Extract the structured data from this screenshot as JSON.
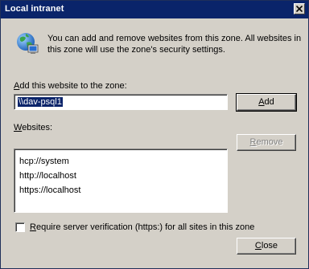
{
  "window": {
    "title": "Local intranet",
    "close_glyph": "✕"
  },
  "info": {
    "icon": "globe-computer-icon",
    "text": "You can add and remove websites from this zone. All websites in this zone will use the zone's security settings."
  },
  "add_section": {
    "label_accel": "A",
    "label_rest": "dd this website to the zone:",
    "input_value": "\\\\dav-psql1",
    "add_button_accel": "A",
    "add_button_rest": "dd"
  },
  "websites_section": {
    "label_accel": "W",
    "label_rest": "ebsites:",
    "items": [
      "hcp://system",
      "http://localhost",
      "https://localhost"
    ],
    "remove_button_accel": "R",
    "remove_button_rest": "emove"
  },
  "require_verification": {
    "label_accel": "R",
    "label_rest": "equire server verification (https:) for all sites in this zone",
    "checked": false
  },
  "close_button": {
    "accel": "C",
    "rest": "lose"
  },
  "colors": {
    "titlebar": "#0a246a",
    "face": "#d4d0c8",
    "selection": "#0a246a"
  }
}
